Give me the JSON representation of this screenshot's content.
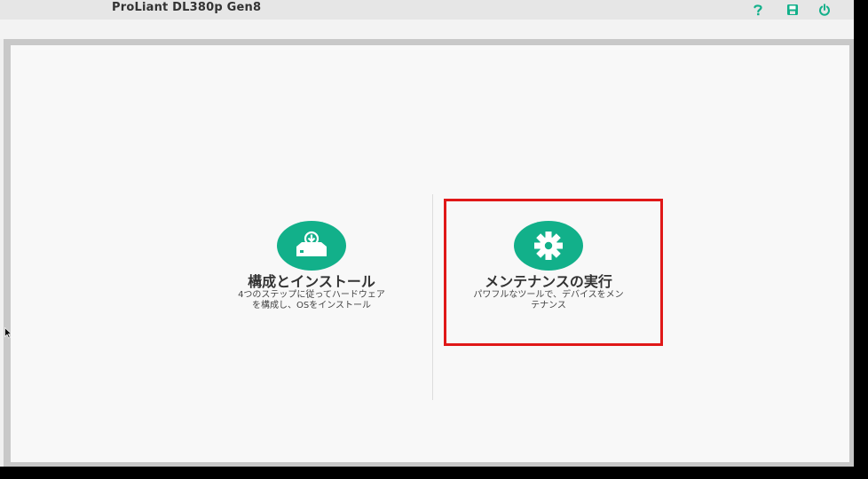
{
  "header": {
    "server_title": "ProLiant DL380p Gen8",
    "icons": [
      "help-icon",
      "save-icon",
      "power-icon"
    ]
  },
  "options": [
    {
      "icon": "install-disk-icon",
      "title": "構成とインストール",
      "description": "4つのステップに従ってハードウェア\nを構成し、OSをインストール"
    },
    {
      "icon": "gear-icon",
      "title": "メンテナンスの実行",
      "description": "パワフルなツールで、デバイスをメン\nテナンス",
      "highlighted": true
    }
  ],
  "colors": {
    "accent": "#12b08a",
    "highlight": "#e01818",
    "title_text": "#333333"
  }
}
